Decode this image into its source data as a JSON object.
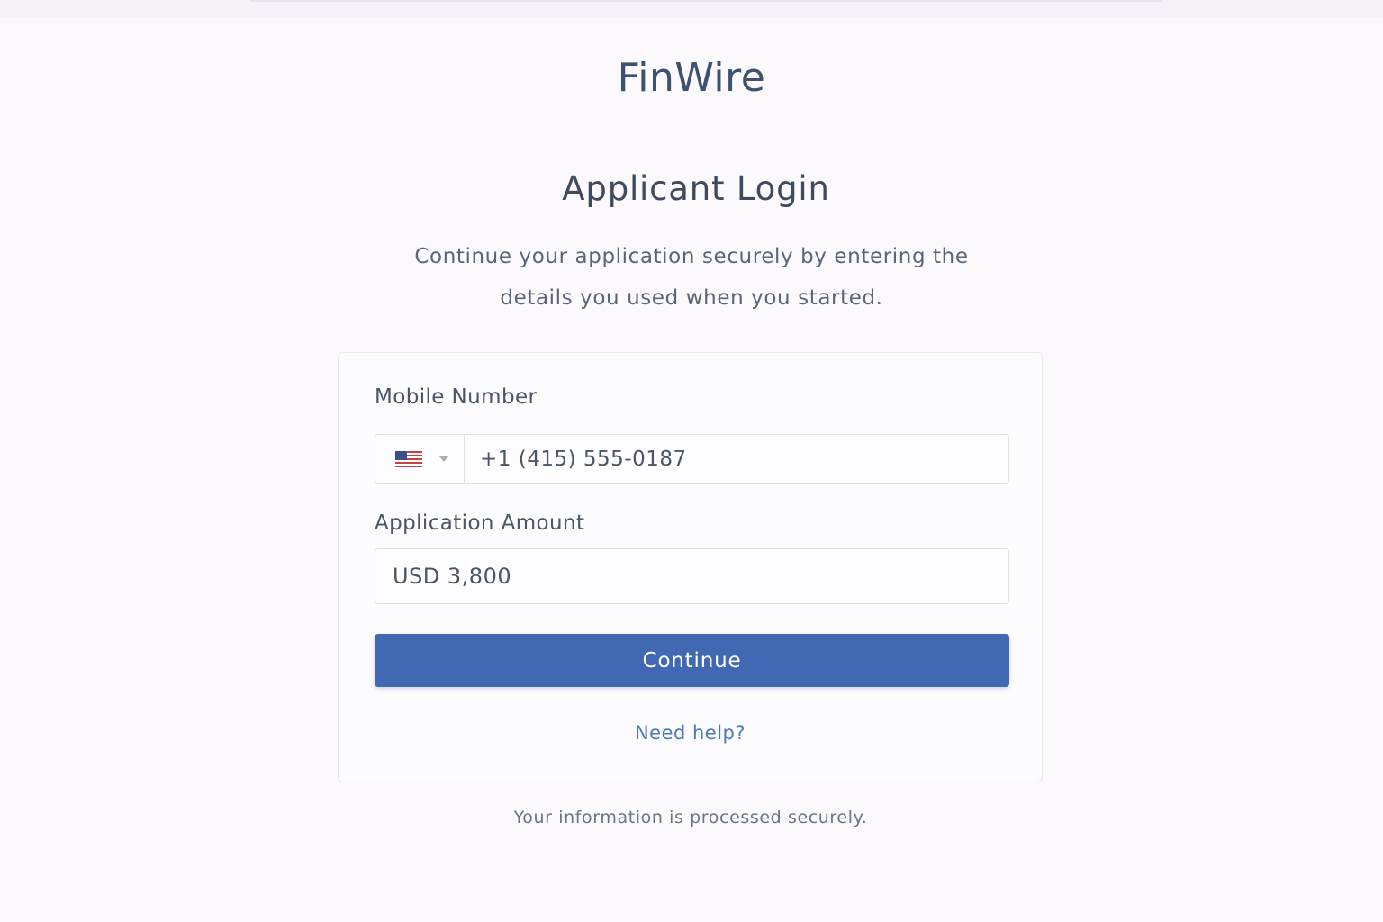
{
  "brand": {
    "name": "FinWire"
  },
  "header": {
    "title": "Applicant Login",
    "subtitle_line1": "Continue your application securely by entering the",
    "subtitle_line2": "details you used when you started."
  },
  "form": {
    "mobile": {
      "label": "Mobile Number",
      "country_flag_icon": "us-flag-icon",
      "value": "+1 (415) 555-0187"
    },
    "amount": {
      "label": "Application Amount",
      "value": "USD 3,800"
    },
    "continue_label": "Continue",
    "help_label": "Need help?"
  },
  "footer": {
    "note": "Your information is processed securely."
  },
  "colors": {
    "background": "#fbf9fc",
    "primary": "#4169b3",
    "link": "#4c78bd",
    "brand_text": "#3d5170"
  }
}
